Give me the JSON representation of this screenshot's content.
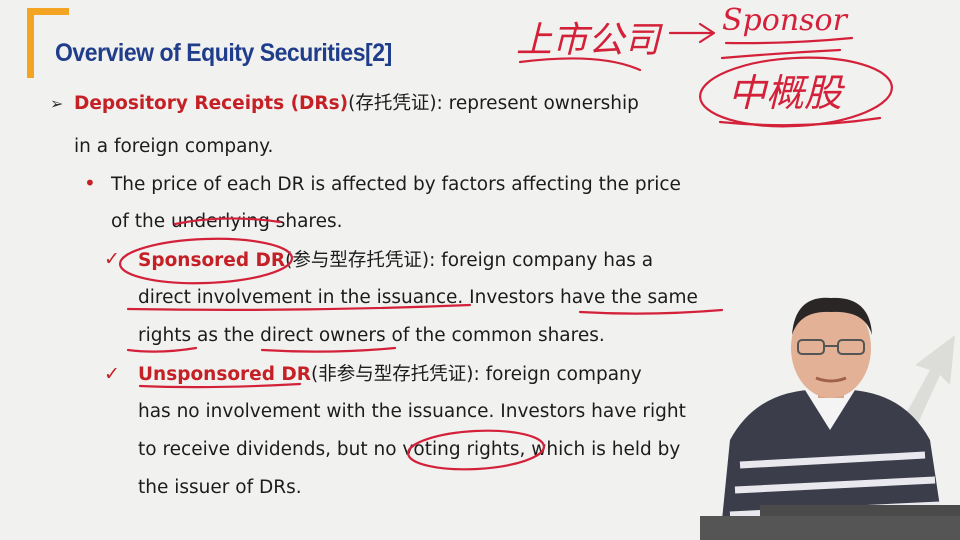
{
  "slide": {
    "title": "Overview of Equity Securities[2]",
    "lines": {
      "l1_term": "Depository Receipts (DRs)",
      "l1_cn": "(存托凭证)",
      "l1_rest": ": represent ownership",
      "l2": "in a foreign company.",
      "l3": "The price of each DR is affected by factors affecting the price",
      "l4": "of the underlying shares.",
      "l5_term": "Sponsored DR",
      "l5_cn": "(参与型存托凭证)",
      "l5_rest": ": foreign company has a",
      "l6": "direct involvement in the issuance. Investors have the same",
      "l7": "rights as the direct owners of the common shares.",
      "l8_term": "Unsponsored DR",
      "l8_cn": "(非参与型存托凭证)",
      "l8_rest": ": foreign company",
      "l9": "has no involvement with the issuance. Investors have right",
      "l10": "to receive dividends, but no voting rights, which is held by",
      "l11": "the issuer of DRs."
    },
    "markers": {
      "arrow": "➢",
      "dot": "•",
      "check": "✓"
    }
  },
  "annotations": {
    "handwriting_1": "上市公司",
    "arrow": "→",
    "handwriting_2": "Sponsor",
    "handwriting_3": "中概股"
  },
  "colors": {
    "title_blue": "#1f3d8a",
    "accent_orange": "#f2a422",
    "term_red": "#c42026",
    "ink_red": "#d4213a"
  }
}
